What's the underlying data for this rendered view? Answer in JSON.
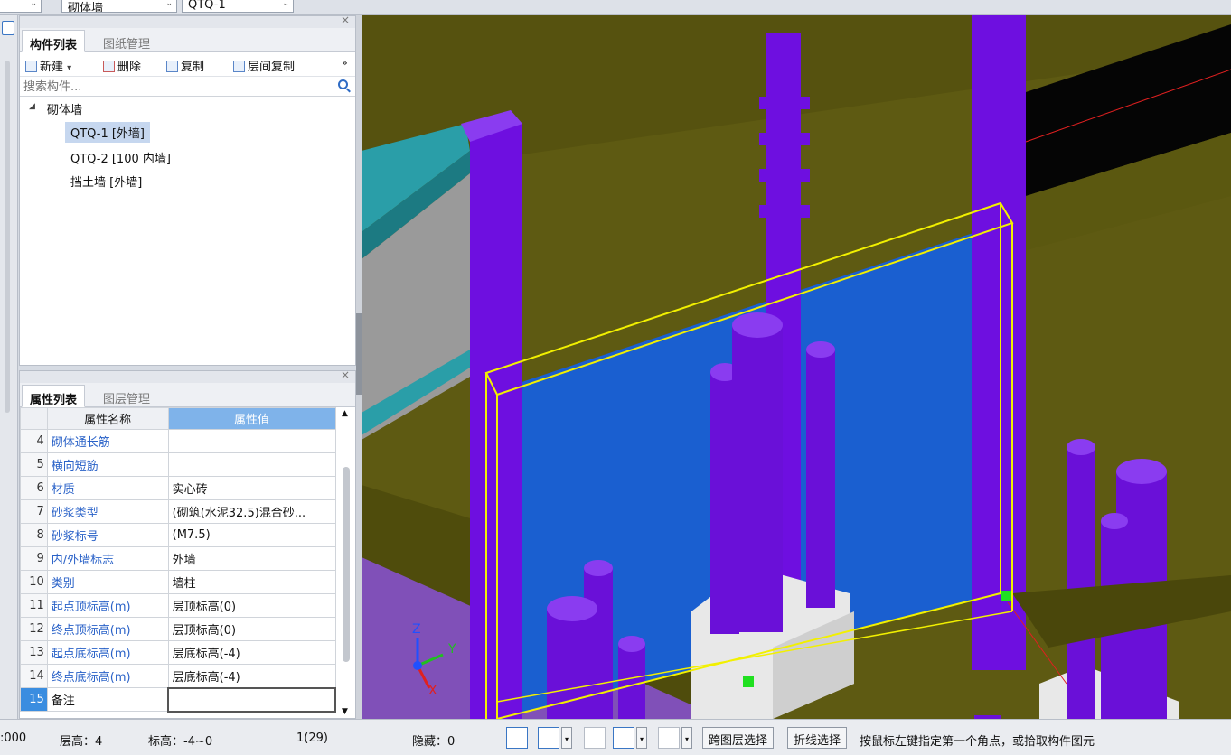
{
  "topbar": {
    "combo_type": "砌体墙",
    "combo_item": "QTQ-1"
  },
  "component_panel": {
    "close": "×",
    "tabs": [
      {
        "label": "构件列表",
        "active": true
      },
      {
        "label": "图纸管理",
        "active": false
      }
    ],
    "toolbar": {
      "new": "新建",
      "new_arrow": "▾",
      "delete": "删除",
      "copy": "复制",
      "floor_copy": "层间复制",
      "more": "»"
    },
    "search_placeholder": "搜索构件...",
    "tree": {
      "root": "砌体墙",
      "root_arrow": "◢",
      "items": [
        "QTQ-1 [外墙]",
        "QTQ-2 [100 内墙]",
        "挡土墙 [外墙]"
      ]
    }
  },
  "property_panel": {
    "close": "×",
    "tabs": [
      {
        "label": "属性列表",
        "active": true
      },
      {
        "label": "图层管理",
        "active": false
      }
    ],
    "headers": {
      "name": "属性名称",
      "value": "属性值"
    },
    "rows": [
      {
        "n": "4",
        "name": "砌体通长筋",
        "value": ""
      },
      {
        "n": "5",
        "name": "横向短筋",
        "value": ""
      },
      {
        "n": "6",
        "name": "材质",
        "value": "实心砖"
      },
      {
        "n": "7",
        "name": "砂浆类型",
        "value": "(砌筑(水泥32.5)混合砂..."
      },
      {
        "n": "8",
        "name": "砂浆标号",
        "value": "(M7.5)"
      },
      {
        "n": "9",
        "name": "内/外墙标志",
        "value": "外墙"
      },
      {
        "n": "10",
        "name": "类别",
        "value": "墙柱"
      },
      {
        "n": "11",
        "name": "起点顶标高(m)",
        "value": "层顶标高(0)"
      },
      {
        "n": "12",
        "name": "终点顶标高(m)",
        "value": "层顶标高(0)"
      },
      {
        "n": "13",
        "name": "起点底标高(m)",
        "value": "层底标高(-4)"
      },
      {
        "n": "14",
        "name": "终点底标高(m)",
        "value": "层底标高(-4)"
      },
      {
        "n": "15",
        "name": "备注",
        "value": ""
      }
    ]
  },
  "viewport": {
    "axes": {
      "z": "Z",
      "y": "Y",
      "x": "X"
    },
    "colors": {
      "olive": "#5e5a12",
      "purple": "#6e0fe0",
      "blue": "#1a5fd0",
      "teal": "#2a9ea8",
      "selection": "#f2f000"
    }
  },
  "statusbar": {
    "scale": ":000",
    "floor_height": "层高：4",
    "elevation": "标高：-4~0",
    "count": "1(29)",
    "hidden": "隐藏：0",
    "cross_layer": "跨图层选择",
    "polyline": "折线选择",
    "hint": "按鼠标左键指定第一个角点，或拾取构件图元"
  }
}
